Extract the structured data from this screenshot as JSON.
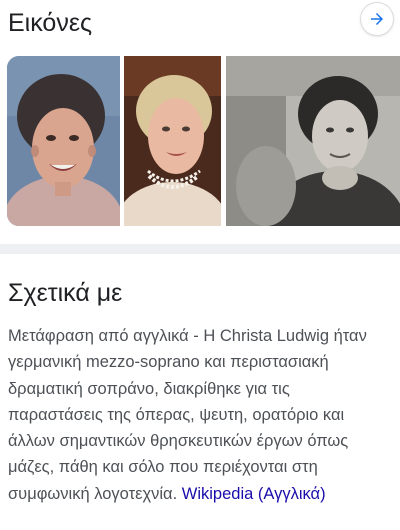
{
  "images_panel": {
    "title": "Εικόνες",
    "more_button_icon": "arrow-right-icon",
    "thumbnails": [
      {
        "name": "image-thumbnail-1"
      },
      {
        "name": "image-thumbnail-2"
      },
      {
        "name": "image-thumbnail-3"
      }
    ]
  },
  "about_panel": {
    "title": "Σχετικά με",
    "description": "Μετάφραση από αγγλικά - Η Christa Ludwig ήταν γερμανική mezzo-soprano και περιστασιακή δραματική σοπράνο, διακρίθηκε για τις παραστάσεις της όπερας, ψευτη, ορατόριο και άλλων σημαντικών θρησκευτικών έργων όπως μάζες, πάθη και σόλο που περιέχονται στη συμφωνική λογοτεχνία.",
    "source_link": "Wikipedia (Αγγλικά)"
  },
  "colors": {
    "link": "#1a0dab",
    "body_text": "#4d5156",
    "heading": "#202124",
    "divider": "#eef0f3",
    "accent": "#1a73e8"
  }
}
